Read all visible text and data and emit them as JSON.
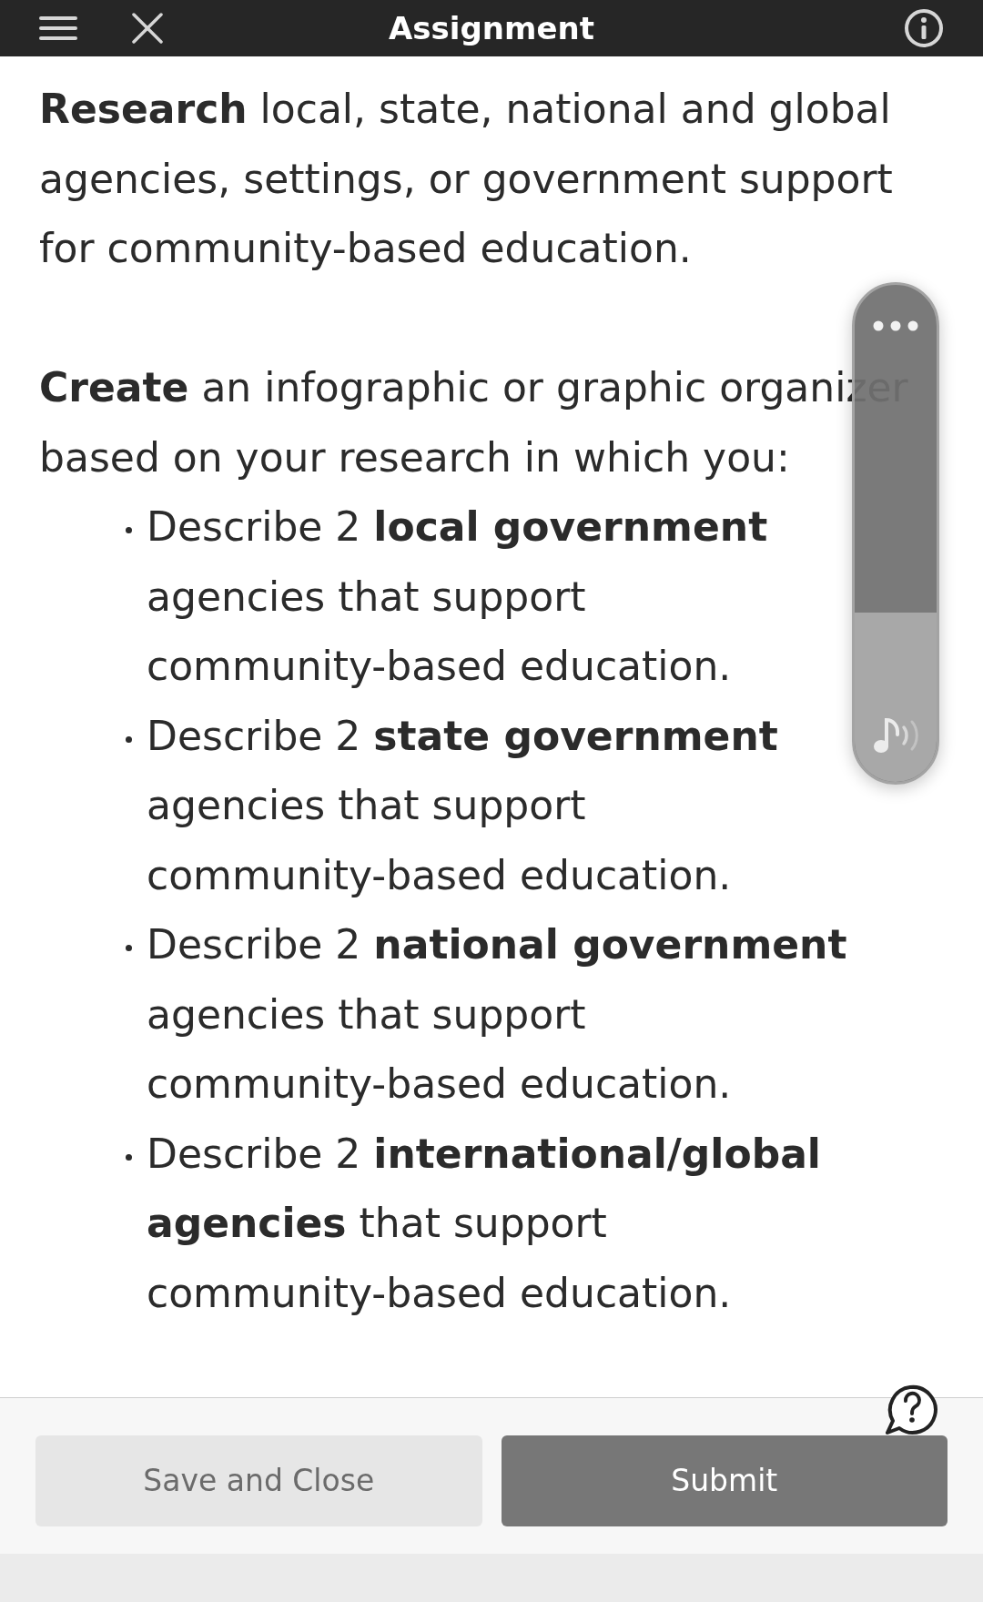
{
  "header": {
    "title": "Assignment"
  },
  "instructions": {
    "paragraphs": [
      "**Research** local, state, national and global agencies, settings, or government support for community-based education.",
      "**Create** an infographic or graphic organizer based on your research in which you:"
    ],
    "list_items": [
      "Describe 2 **local government** agencies that support community-based education.",
      "Describe 2 **state government** agencies that support community-based education.",
      "Describe 2 **national government** agencies that support community-based education.",
      "Describe 2 **international/global agencies** that support community-based education."
    ]
  },
  "volume_panel": {
    "level": 0.34
  },
  "footer": {
    "buttons": [
      {
        "label": "Save and Close",
        "kind": "secondary"
      },
      {
        "label": "Submit",
        "kind": "primary"
      }
    ]
  }
}
